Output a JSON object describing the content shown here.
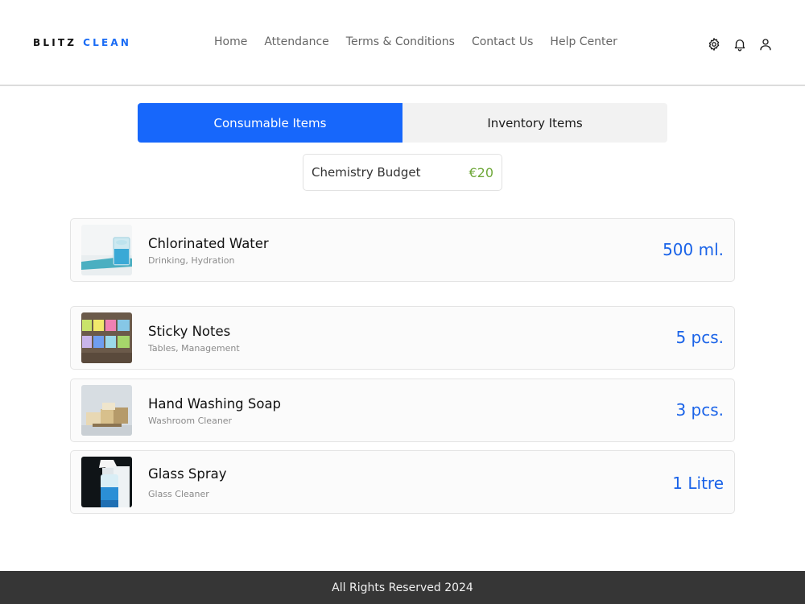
{
  "brand": {
    "word1": "BLITZ",
    "word2": "CLEAN",
    "accent_color": "#1a6cf5"
  },
  "nav": [
    {
      "label": "Home"
    },
    {
      "label": "Attendance"
    },
    {
      "label": "Terms & Conditions"
    },
    {
      "label": "Contact Us"
    },
    {
      "label": "Help Center"
    }
  ],
  "header_icons": [
    "gear-icon",
    "bell-icon",
    "user-icon"
  ],
  "tabs": {
    "active": "Consumable Items",
    "inactive": "Inventory Items",
    "active_color": "#1767fb"
  },
  "budget": {
    "label": "Chemistry Budget",
    "value": "€20",
    "value_color": "#6fa83a"
  },
  "items": [
    {
      "name": "Chlorinated Water",
      "tags": "Drinking, Hydration",
      "qty": "500 ml."
    },
    {
      "name": "Sticky Notes",
      "tags": "Tables, Management",
      "qty": "5 pcs."
    },
    {
      "name": "Hand Washing Soap",
      "tags": "Washroom Cleaner",
      "qty": "3 pcs."
    },
    {
      "name": "Glass Spray",
      "tags": "Glass Cleaner",
      "qty": "1 Litre"
    }
  ],
  "footer": {
    "text": "All Rights Reserved 2024"
  }
}
